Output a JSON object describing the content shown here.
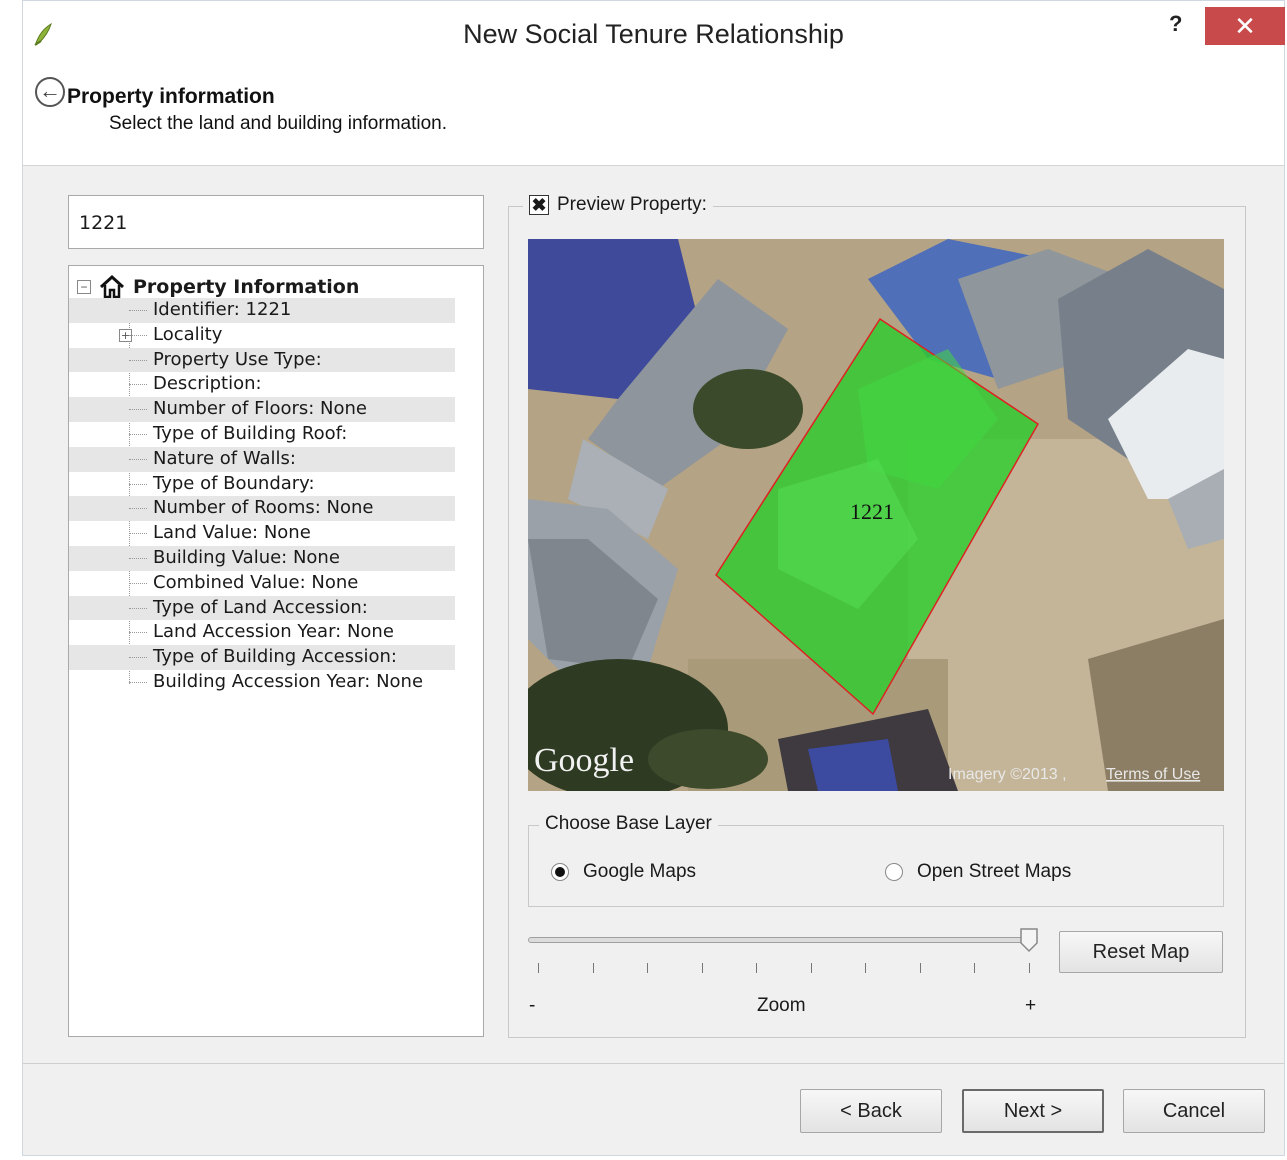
{
  "window": {
    "title": "New Social Tenure Relationship",
    "help_label": "?",
    "close_label": "✕"
  },
  "header": {
    "title": "Property information",
    "subtitle": "Select the land and building information."
  },
  "search": {
    "value": "1221"
  },
  "tree": {
    "root_label": "Property Information",
    "items": [
      {
        "label": "Identifier: 1221"
      },
      {
        "label": "Locality",
        "expandable": true
      },
      {
        "label": "Property Use Type:"
      },
      {
        "label": "Description:"
      },
      {
        "label": "Number of Floors: None"
      },
      {
        "label": "Type of Building Roof:"
      },
      {
        "label": "Nature of Walls:"
      },
      {
        "label": "Type of Boundary:"
      },
      {
        "label": "Number of Rooms: None"
      },
      {
        "label": "Land Value: None"
      },
      {
        "label": "Building Value: None"
      },
      {
        "label": "Combined Value: None"
      },
      {
        "label": "Type of Land Accession:"
      },
      {
        "label": "Land Accession Year: None"
      },
      {
        "label": "Type of Building Accession:"
      },
      {
        "label": "Building Accession Year: None"
      }
    ]
  },
  "preview": {
    "checkbox_label": "Preview Property:",
    "checked": true,
    "parcel_label": "1221",
    "map_logo": "Google",
    "imagery_text": "Imagery ©2013 ,",
    "terms_text": "Terms of Use",
    "parcel_color": "#2ecc2e"
  },
  "base_layer": {
    "legend": "Choose Base Layer",
    "options": [
      {
        "label": "Google Maps",
        "selected": true
      },
      {
        "label": "Open Street Maps",
        "selected": false
      }
    ]
  },
  "zoom": {
    "minus_label": "-",
    "label": "Zoom",
    "plus_label": "+",
    "level": 1.0,
    "reset_label": "Reset Map"
  },
  "footer": {
    "back_label": "< Back",
    "next_label": "Next >",
    "cancel_label": "Cancel"
  }
}
